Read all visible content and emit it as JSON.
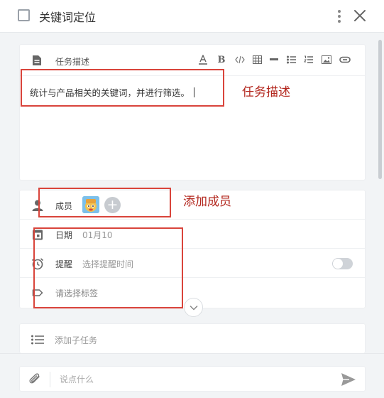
{
  "header": {
    "title": "关键词定位"
  },
  "description": {
    "label": "任务描述",
    "text": "统计与产品相关的关键词，并进行筛选。"
  },
  "toolbar": {
    "items": [
      "text-color-icon",
      "bold-icon",
      "code-icon",
      "table-icon",
      "divider-icon",
      "bullet-list-icon",
      "numbered-list-icon",
      "image-icon",
      "link-icon"
    ],
    "bold_glyph": "B"
  },
  "members": {
    "label": "成员",
    "add_glyph": "+"
  },
  "date": {
    "label": "日期",
    "value": "01月10"
  },
  "reminder": {
    "label": "提醒",
    "placeholder": "选择提醒时间"
  },
  "tags": {
    "placeholder": "请选择标签"
  },
  "subtask": {
    "placeholder": "添加子任务"
  },
  "comment": {
    "placeholder": "说点什么"
  },
  "annotations": {
    "desc_note": "任务描述",
    "members_note": "添加成员"
  },
  "colors": {
    "annotation": "#b3271e",
    "highlight_box": "#d9443b",
    "toggle_off": "#cfd3d8"
  }
}
